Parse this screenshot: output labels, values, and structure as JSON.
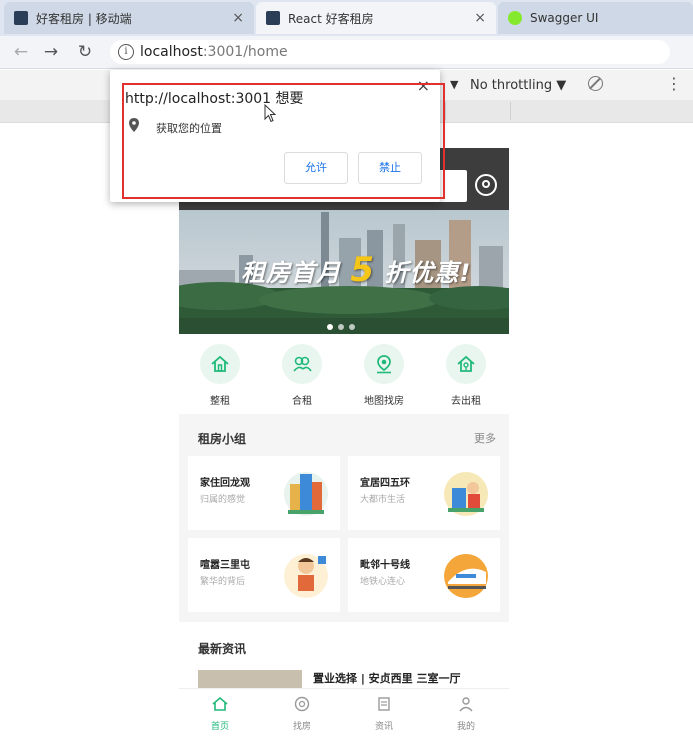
{
  "browser": {
    "tabs": [
      {
        "title": "好客租房 | 移动端"
      },
      {
        "title": "React 好客租房"
      },
      {
        "title": "Swagger UI"
      }
    ],
    "close_glyph": "×",
    "address": {
      "host": "localhost",
      "path": ":3001/home",
      "info_glyph": "i"
    }
  },
  "devtools": {
    "dropdown_glyph": "▼",
    "throttle": "No throttling ▼",
    "more_glyph": "⋮"
  },
  "permission_popup": {
    "origin_text": "http://localhost:3001 想要",
    "message": "获取您的位置",
    "allow_label": "允许",
    "block_label": "禁止",
    "close_glyph": "×"
  },
  "banner": {
    "text_pre": "租房首月",
    "text_num": "5",
    "text_post": "折优惠!"
  },
  "nav": [
    {
      "label": "整租",
      "icon": "house-icon"
    },
    {
      "label": "合租",
      "icon": "people-icon"
    },
    {
      "label": "地图找房",
      "icon": "map-pin-icon"
    },
    {
      "label": "去出租",
      "icon": "house-rent-icon"
    }
  ],
  "groups": {
    "title": "租房小组",
    "more": "更多",
    "items": [
      {
        "name": "家住回龙观",
        "desc": "归属的感觉"
      },
      {
        "name": "宜居四五环",
        "desc": "大都市生活"
      },
      {
        "name": "喧嚣三里屯",
        "desc": "繁华的背后"
      },
      {
        "name": "毗邻十号线",
        "desc": "地铁心连心"
      }
    ]
  },
  "news": {
    "title": "最新资讯",
    "headline": "置业选择 | 安贞西里 三室一厅"
  },
  "tabbar": [
    {
      "label": "首页",
      "active": true
    },
    {
      "label": "找房",
      "active": false
    },
    {
      "label": "资讯",
      "active": false
    },
    {
      "label": "我的",
      "active": false
    }
  ],
  "colors": {
    "accent": "#21b97a",
    "highlight": "#e03030",
    "link": "#1a73e8"
  }
}
